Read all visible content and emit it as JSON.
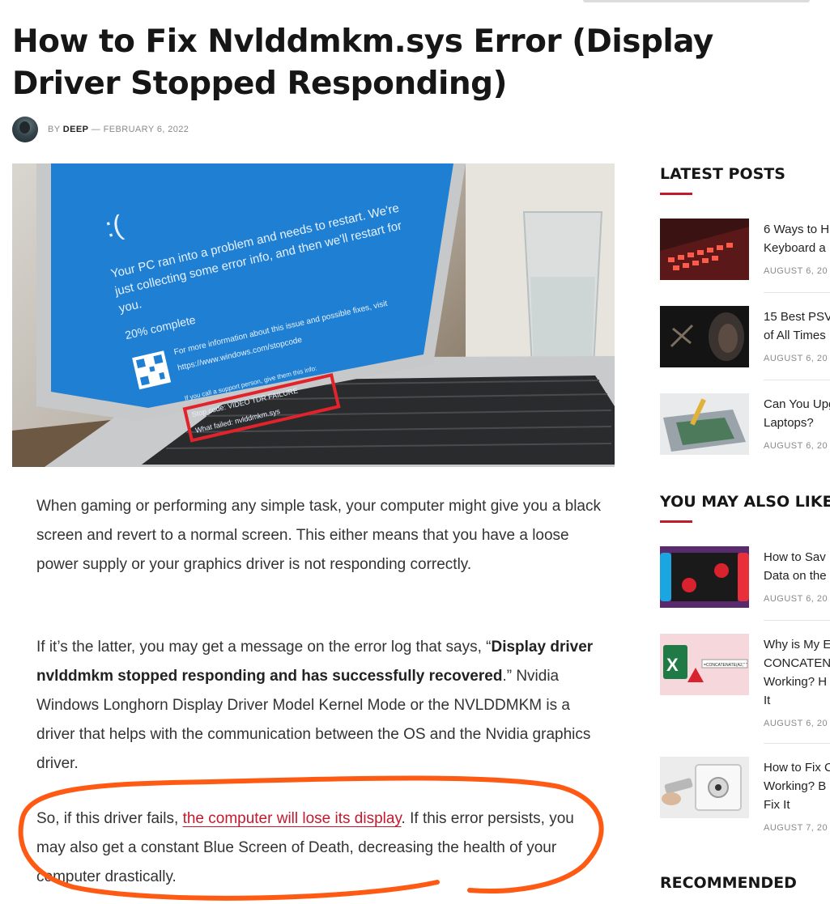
{
  "article": {
    "title": "How to Fix Nvlddmkm.sys Error (Display Driver Stopped Responding)",
    "meta": {
      "by": "BY",
      "author": "DEEP",
      "separator": "—",
      "date": "FEBRUARY 6, 2022"
    },
    "hero_image": {
      "icon": "laptop-bsod-image",
      "screen_lines": [
        ":(",
        "Your PC ran into a problem and needs to restart. We're",
        "just collecting some error info, and then we'll restart for",
        "you.",
        "20% complete",
        "For more information about this issue and possible fixes, visit",
        "https://www.windows.com/stopcode",
        "If you call a support person, give them this info:",
        "Stop code: VIDEO TDR FAILURE",
        "What failed: nvlddmkm.sys"
      ]
    },
    "paragraphs": {
      "p1": "When gaming or performing any simple task, your computer might give you a black screen and revert to a normal screen. This either means that you have a loose power supply or your graphics driver is not responding correctly.",
      "p2_pre": "If it’s the latter, you may get a message on the error log that says, “",
      "p2_bold": "Display driver nvlddmkm stopped responding and has successfully recovered",
      "p2_post": ".” Nvidia Windows Longhorn Display Driver Model Kernel Mode or the NVLDDMKM is a driver that helps with the communication between the OS and the Nvidia graphics driver.",
      "p3_pre": "So, if this driver fails, ",
      "p3_link": "the computer will lose its display",
      "p3_post": ". If this error persists, you may also get a constant Blue Screen of Death, decreasing the health of your computer drastically."
    }
  },
  "sidebar": {
    "latest_posts": {
      "heading": "LATEST POSTS",
      "items": [
        {
          "title_lines": [
            "6 Ways to H",
            "Keyboard a"
          ],
          "date": "AUGUST 6, 20",
          "thumb_icon": "rgb-keyboard-thumbnail"
        },
        {
          "title_lines": [
            "15 Best PSV",
            "of All Times"
          ],
          "date": "AUGUST 6, 20",
          "thumb_icon": "game-character-thumbnail"
        },
        {
          "title_lines": [
            "Can You Upg",
            "Laptops?"
          ],
          "date": "AUGUST 6, 20",
          "thumb_icon": "laptop-repair-thumbnail"
        }
      ]
    },
    "you_may_also_like": {
      "heading": "YOU MAY ALSO LIKE",
      "items": [
        {
          "title_lines": [
            "How to Sav",
            "Data on the"
          ],
          "date": "AUGUST 6, 20",
          "thumb_icon": "nintendo-switch-thumbnail"
        },
        {
          "title_lines": [
            "Why is My E",
            "CONCATENA",
            "Working? H",
            "It"
          ],
          "date": "AUGUST 6, 20",
          "thumb_icon": "excel-warning-thumbnail",
          "thumb_text": "=CONCATENATE(A2,\" \""
        },
        {
          "title_lines": [
            "How to Fix C",
            "Working? B",
            "Fix It"
          ],
          "date": "AUGUST 7, 20",
          "thumb_icon": "coax-plug-thumbnail"
        }
      ]
    },
    "recommended": {
      "heading": "RECOMMENDED"
    }
  },
  "colors": {
    "accent": "#c4192d",
    "annotation": "#ff5a14",
    "bsod_blue": "#1e7fd3",
    "highlight_box": "#e3232b"
  }
}
